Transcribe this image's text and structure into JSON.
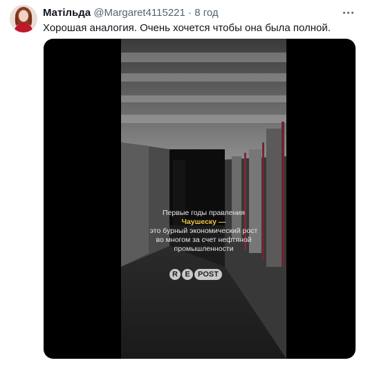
{
  "tweet": {
    "author_name": "Матільда",
    "handle": "@Margaret4115221",
    "separator": "·",
    "time": "8 год",
    "text": "Хорошая аналогия. Очень хочется чтобы она была полной.",
    "more_icon": "more-horizontal-icon"
  },
  "video": {
    "caption_line1": "Первые годы правления",
    "caption_highlight": "Чаушеску —",
    "caption_line3": "это бурный экономический рост",
    "caption_line4": "во многом за счет нефтяной",
    "caption_line5": "промышленности",
    "logo_letter_r": "R",
    "logo_letter_e": "E",
    "logo_word": "POST",
    "highlight_color": "#f2c640"
  }
}
